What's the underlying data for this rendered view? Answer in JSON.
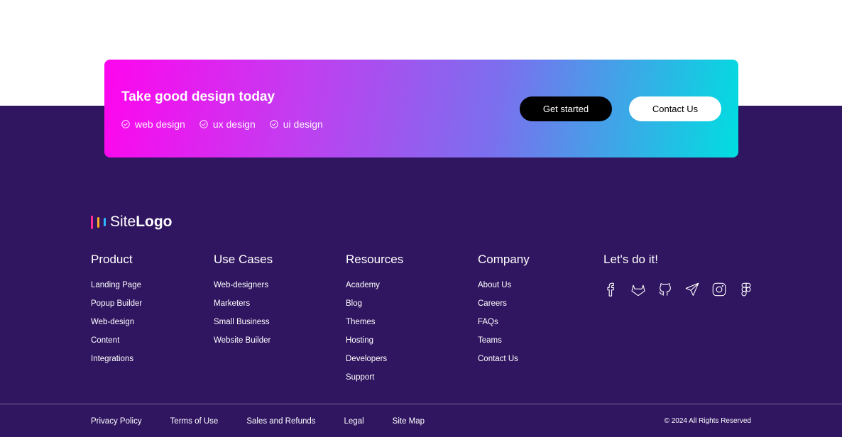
{
  "cta": {
    "title": "Take good design today",
    "tags": [
      "web design",
      "ux design",
      "ui design"
    ],
    "primary_button": "Get started",
    "secondary_button": "Contact Us"
  },
  "logo": {
    "text_light": "Site",
    "text_bold": "Logo",
    "bar_colors": [
      "#ff2d92",
      "#ffb020",
      "#2db8ff"
    ]
  },
  "columns": [
    {
      "title": "Product",
      "items": [
        "Landing Page",
        "Popup Builder",
        "Web-design",
        "Content",
        "Integrations"
      ]
    },
    {
      "title": "Use Cases",
      "items": [
        "Web-designers",
        "Marketers",
        "Small Business",
        "Website Builder"
      ]
    },
    {
      "title": "Resources",
      "items": [
        "Academy",
        "Blog",
        "Themes",
        "Hosting",
        "Developers",
        "Support"
      ]
    },
    {
      "title": "Company",
      "items": [
        "About Us",
        "Careers",
        "FAQs",
        "Teams",
        "Contact Us"
      ]
    }
  ],
  "social": {
    "title": "Let's do it!",
    "icons": [
      "facebook-icon",
      "gitlab-icon",
      "github-icon",
      "telegram-icon",
      "instagram-icon",
      "figma-icon"
    ]
  },
  "legal_links": [
    "Privacy Policy",
    "Terms of Use",
    "Sales and Refunds",
    "Legal",
    "Site Map"
  ],
  "copyright": "© 2024 All Rights Reserved",
  "colors": {
    "footer_bg": "#301660",
    "gradient_start": "#ff05ee",
    "gradient_end": "#00dee0",
    "primary_button_bg": "#000000",
    "secondary_button_bg": "#ffffff"
  }
}
